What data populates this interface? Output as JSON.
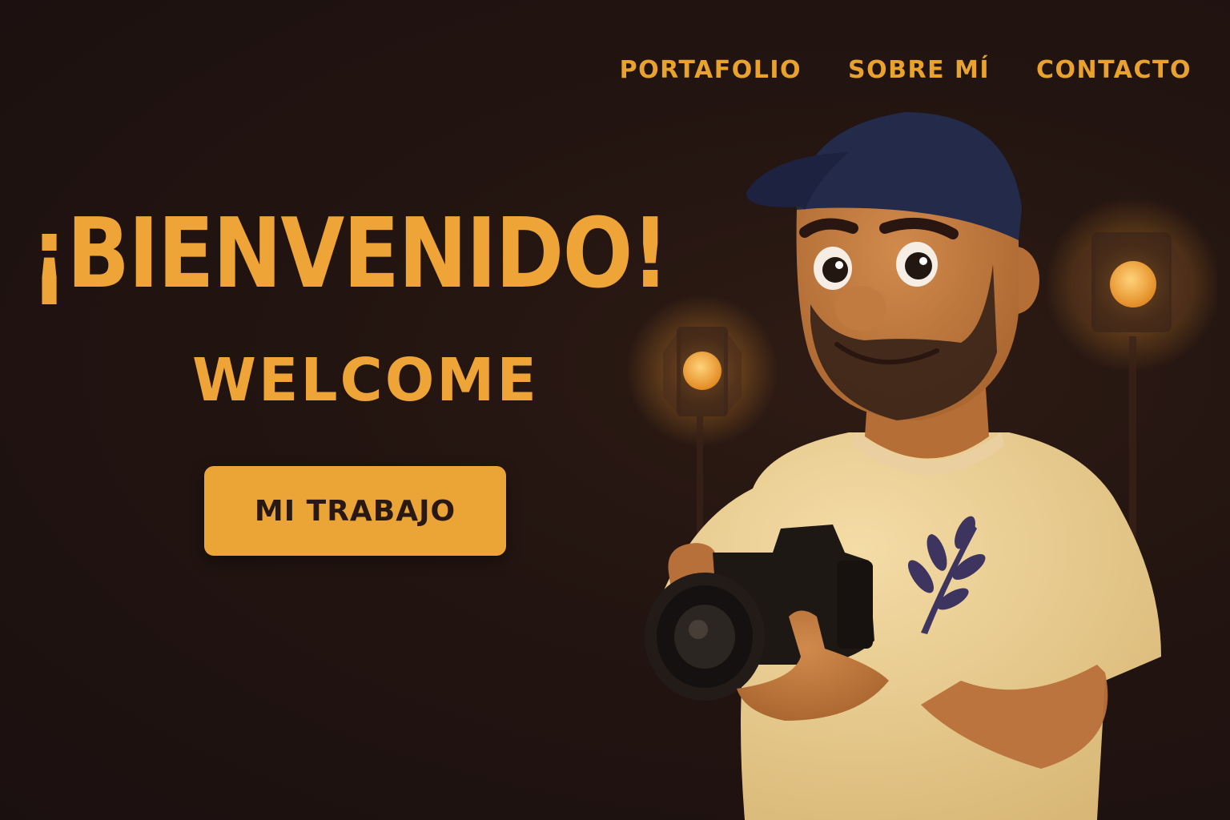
{
  "nav": {
    "items": [
      {
        "label": "PORTAFOLIO"
      },
      {
        "label": "SOBRE MÍ"
      },
      {
        "label": "CONTACTO"
      }
    ]
  },
  "hero": {
    "title": "¡BIENVENIDO!",
    "subtitle": "WELCOME",
    "cta_label": "MI TRABAJO"
  },
  "colors": {
    "background": "#221410",
    "accent": "#eea436",
    "button_text": "#2a1812",
    "cap": "#232a4a",
    "shirt": "#f0d59a",
    "skin": "#c27a3e",
    "leaf": "#3d3560"
  },
  "illustration": {
    "icons": [
      "photographer-avatar",
      "camera-icon",
      "studio-light-icon",
      "leaf-icon"
    ]
  }
}
